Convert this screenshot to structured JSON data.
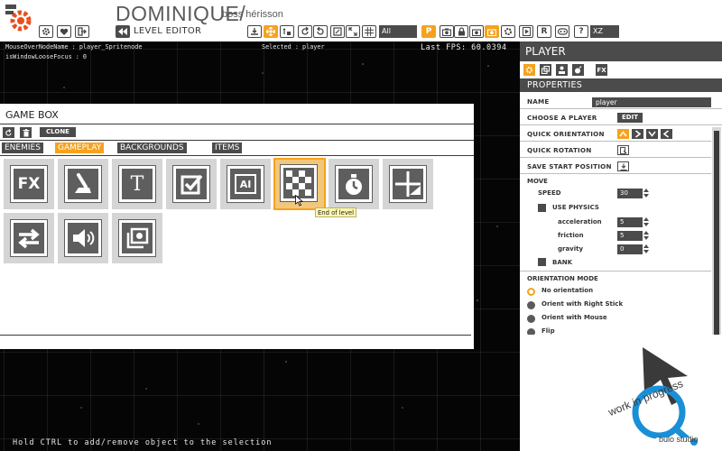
{
  "header": {
    "title": "DOMINIQUE/",
    "subtitle": "boss hérisson",
    "editor_mode": "LEVEL EDITOR",
    "filter_value": "All",
    "plane_value": "XZ",
    "letter_p": "P",
    "letter_r": "R",
    "help": "?"
  },
  "debug": {
    "line1": "MouseOverNodeName : player_Spritenode",
    "line2": "isWindowLooseFocus : 0",
    "selected": "Selected : player",
    "fps_label": "Last  FPS: 60.0394"
  },
  "gamebox": {
    "title": "GAME BOX",
    "clone_label": "CLONE",
    "tabs": [
      {
        "label": "ENEMIES",
        "active": false
      },
      {
        "label": "GAMEPLAY",
        "active": true
      },
      {
        "label": "BACKGROUNDS",
        "active": false
      },
      {
        "label": "ITEMS",
        "active": false
      }
    ],
    "tiles": [
      {
        "icon": "fx-icon",
        "text": "FX"
      },
      {
        "icon": "joystick-icon",
        "text": ""
      },
      {
        "icon": "text-icon",
        "text": "T"
      },
      {
        "icon": "checkbox-icon",
        "text": ""
      },
      {
        "icon": "ai-icon",
        "text": "AI"
      },
      {
        "icon": "checkered-flag-icon",
        "text": "",
        "selected": true
      },
      {
        "icon": "timer-icon",
        "text": ""
      },
      {
        "icon": "split-icon",
        "text": ""
      },
      {
        "icon": "swap-icon",
        "text": ""
      },
      {
        "icon": "speaker-icon",
        "text": ""
      },
      {
        "icon": "photos-icon",
        "text": ""
      }
    ],
    "tooltip": "End of level"
  },
  "panel": {
    "title": "PLAYER",
    "properties_label": "PROPERTIES",
    "name_label": "NAME",
    "name_value": "player",
    "choose_player_label": "CHOOSE A PLAYER",
    "edit_label": "EDIT",
    "quick_orientation_label": "QUICK ORIENTATION",
    "quick_rotation_label": "QUICK ROTATION",
    "save_start_label": "SAVE START POSITION",
    "move_label": "MOVE",
    "speed_label": "SPEED",
    "speed_value": "30",
    "use_physics_label": "USE PHYSICS",
    "acceleration_label": "acceleration",
    "acceleration_value": "5",
    "friction_label": "friction",
    "friction_value": "5",
    "gravity_label": "gravity",
    "gravity_value": "0",
    "bank_label": "BANK",
    "orientation_mode_label": "ORIENTATION MODE",
    "orientation_options": [
      {
        "label": "No orientation",
        "selected": true
      },
      {
        "label": "Orient with Right Stick",
        "selected": false
      },
      {
        "label": "Orient with Mouse",
        "selected": false
      },
      {
        "label": "Flip",
        "selected": false
      }
    ]
  },
  "branding": {
    "line1": "work in progress",
    "line2": "bulo studio"
  },
  "status": {
    "hint": "Hold CTRL to add/remove object to the selection"
  },
  "colors": {
    "accent": "#f6a21e",
    "dark_gray": "#4b4b4b",
    "panel_bg": "#ffffff",
    "logo_blue": "#1a8fd6"
  }
}
